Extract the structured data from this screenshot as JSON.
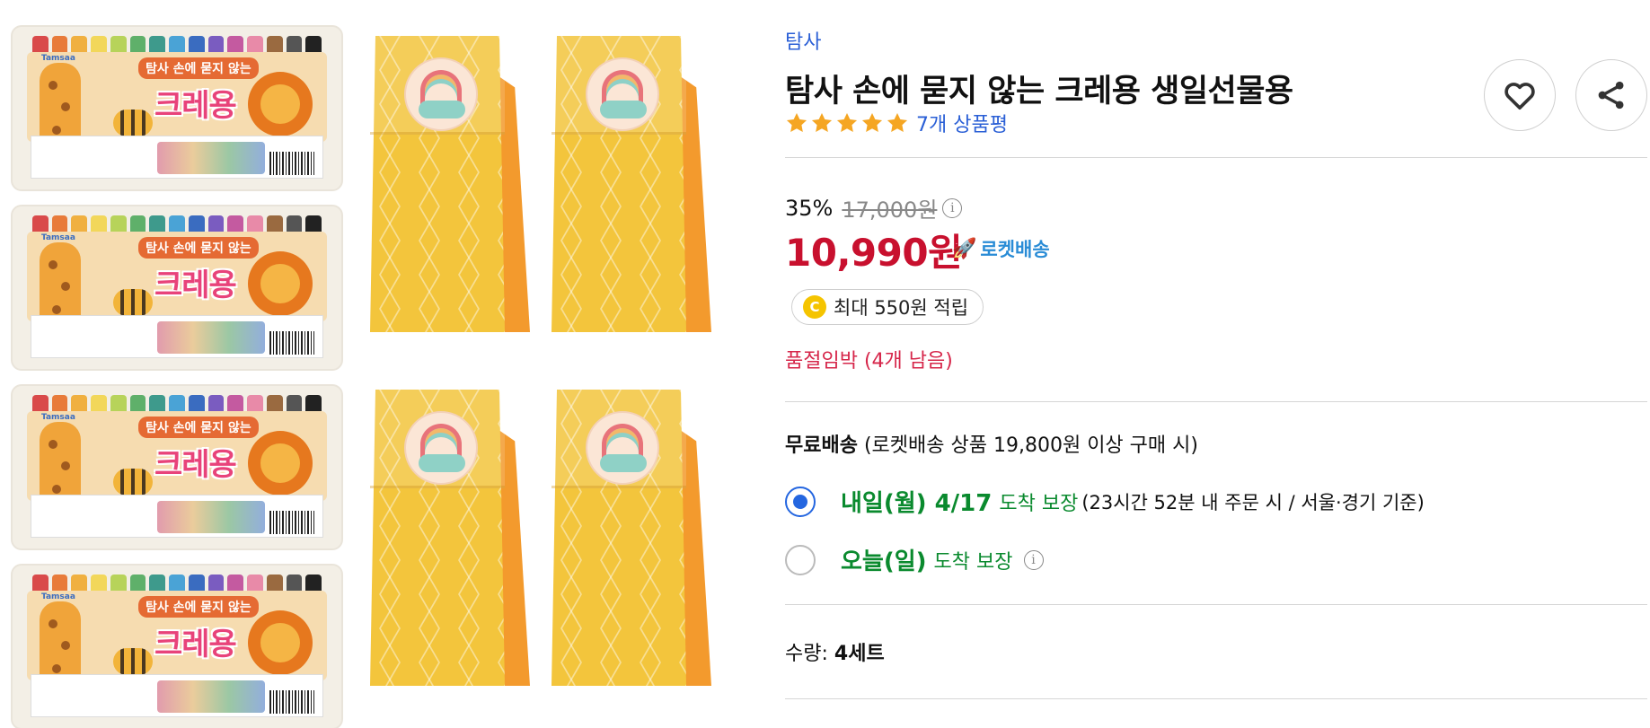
{
  "product": {
    "brand": "탐사",
    "title": "탐사 손에 묻지 않는 크레용 생일선물용",
    "rating_stars": 5,
    "review_text": "7개 상품평"
  },
  "gallery": {
    "box_small_title": "탐사 손에 묻지 않는",
    "box_big_title": "크레용",
    "box_brand": "Tamsaa",
    "crayon_colors": [
      "#d94a4a",
      "#e87b3a",
      "#f0b040",
      "#f2d75a",
      "#b7d35a",
      "#5fb06a",
      "#3e9a8c",
      "#4aa3d6",
      "#3a6cc0",
      "#7a5cc0",
      "#c45aa0",
      "#e88aa8",
      "#9a6a40",
      "#555555",
      "#222222"
    ]
  },
  "pricing": {
    "discount": "35%",
    "original_price": "17,000원",
    "sale_price": "10,990원",
    "rocket_label": "로켓배송",
    "cashback": "최대 550원 적립",
    "coin_letter": "C",
    "stock_warning": "품절임박 (4개 남음)"
  },
  "shipping": {
    "free_label": "무료배송",
    "free_condition": "(로켓배송 상품 19,800원 이상 구매 시)",
    "options": [
      {
        "day": "내일(월) 4/17",
        "guarantee": "도착 보장",
        "note": "(23시간 52분 내 주문 시 / 서울·경기 기준)",
        "selected": true
      },
      {
        "day": "오늘(일)",
        "guarantee": "도착 보장",
        "note": "",
        "selected": false
      }
    ]
  },
  "quantity": {
    "label": "수량:",
    "value": "4세트"
  },
  "icons": {
    "info": "i",
    "heart": "heart-icon",
    "share": "share-icon",
    "rocket": "rocket-icon",
    "star": "star-icon"
  },
  "colors": {
    "link": "#2a5fd6",
    "price": "#c8102e",
    "star": "#f5a623",
    "delivery": "#0a8a2e",
    "stock": "#d6264a"
  }
}
